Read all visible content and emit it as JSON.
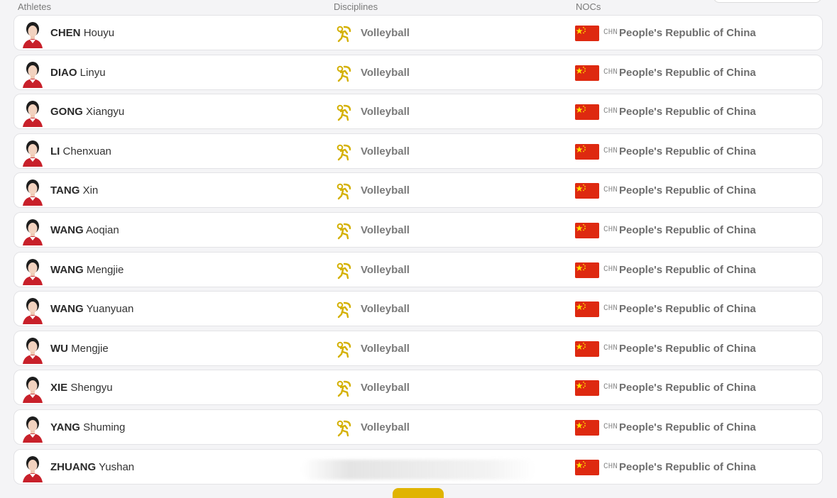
{
  "headers": {
    "athletes": "Athletes",
    "disciplines": "Disciplines",
    "nocs": "NOCs"
  },
  "colors": {
    "accent": "#e0b400",
    "flag_red": "#de2910",
    "flag_yellow": "#ffde00"
  },
  "icons": {
    "discipline": "volleyball-pictogram-icon",
    "flag": "china-flag-icon",
    "avatar": "athlete-portrait-icon"
  },
  "rows": [
    {
      "last": "CHEN",
      "first": "Houyu",
      "discipline": "Volleyball",
      "noc_code": "CHN",
      "noc_name": "People's Republic of China"
    },
    {
      "last": "DIAO",
      "first": "Linyu",
      "discipline": "Volleyball",
      "noc_code": "CHN",
      "noc_name": "People's Republic of China"
    },
    {
      "last": "GONG",
      "first": "Xiangyu",
      "discipline": "Volleyball",
      "noc_code": "CHN",
      "noc_name": "People's Republic of China"
    },
    {
      "last": "LI",
      "first": "Chenxuan",
      "discipline": "Volleyball",
      "noc_code": "CHN",
      "noc_name": "People's Republic of China"
    },
    {
      "last": "TANG",
      "first": "Xin",
      "discipline": "Volleyball",
      "noc_code": "CHN",
      "noc_name": "People's Republic of China"
    },
    {
      "last": "WANG",
      "first": "Aoqian",
      "discipline": "Volleyball",
      "noc_code": "CHN",
      "noc_name": "People's Republic of China"
    },
    {
      "last": "WANG",
      "first": "Mengjie",
      "discipline": "Volleyball",
      "noc_code": "CHN",
      "noc_name": "People's Republic of China"
    },
    {
      "last": "WANG",
      "first": "Yuanyuan",
      "discipline": "Volleyball",
      "noc_code": "CHN",
      "noc_name": "People's Republic of China"
    },
    {
      "last": "WU",
      "first": "Mengjie",
      "discipline": "Volleyball",
      "noc_code": "CHN",
      "noc_name": "People's Republic of China"
    },
    {
      "last": "XIE",
      "first": "Shengyu",
      "discipline": "Volleyball",
      "noc_code": "CHN",
      "noc_name": "People's Republic of China"
    },
    {
      "last": "YANG",
      "first": "Shuming",
      "discipline": "Volleyball",
      "noc_code": "CHN",
      "noc_name": "People's Republic of China"
    },
    {
      "last": "ZHUANG",
      "first": "Yushan",
      "discipline": "",
      "noc_code": "CHN",
      "noc_name": "People's Republic of China"
    }
  ]
}
